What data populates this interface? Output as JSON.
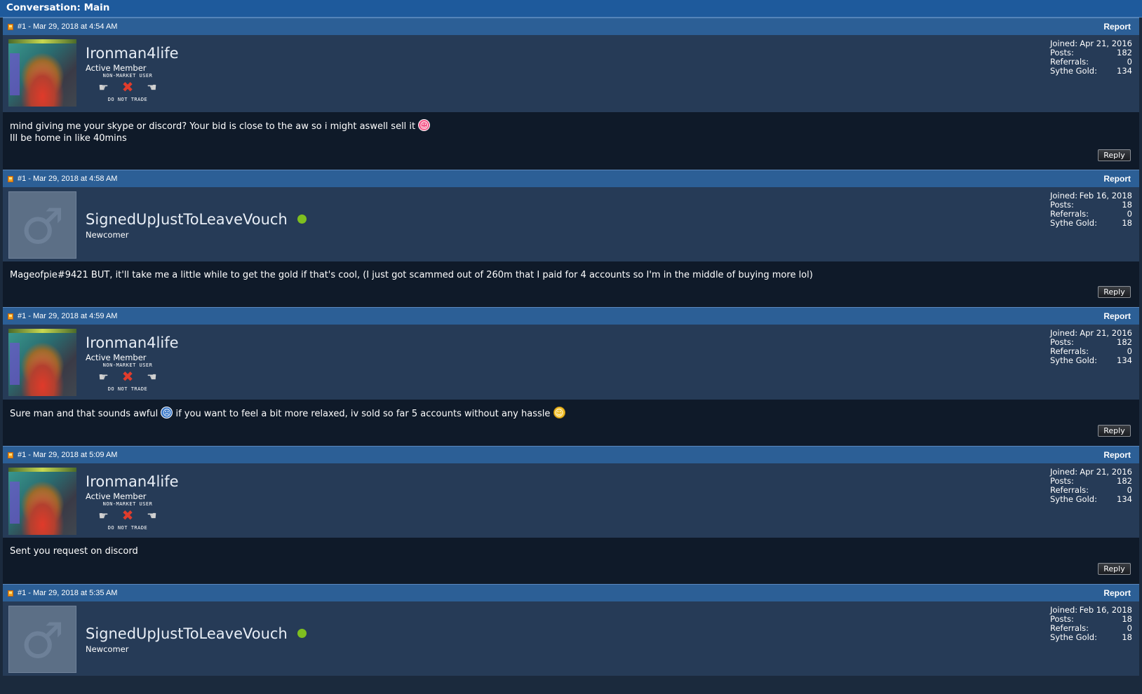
{
  "title": "Conversation: Main",
  "report_label": "Report",
  "reply_label": "Reply",
  "stat_labels": {
    "joined": "Joined:",
    "posts": "Posts:",
    "referrals": "Referrals:",
    "gold": "Sythe Gold:"
  },
  "badge": {
    "top": "NON-MARKET USER",
    "bottom": "DO NOT TRADE"
  },
  "users": {
    "iron": {
      "name": "Ironman4life",
      "title": "Active Member",
      "joined": "Apr 21, 2016",
      "posts": "182",
      "referrals": "0",
      "gold": "134"
    },
    "signed": {
      "name": "SignedUpJustToLeaveVouch",
      "title": "Newcomer",
      "joined": "Feb 16, 2018",
      "posts": "18",
      "referrals": "0",
      "gold": "18",
      "online_color": "#7fbf1f"
    }
  },
  "posts": [
    {
      "header": "#1 - Mar 29, 2018 at 4:54 AM",
      "line1": "mind giving me your skype or discord? Your bid is close to the aw so i might aswell sell it",
      "line2": "Ill be home in like 40mins"
    },
    {
      "header": "#1 - Mar 29, 2018 at 4:58 AM",
      "line1": "Mageofpie#9421 BUT, it'll take me a little while to get the gold if that's cool, (I just got scammed out of 260m that I paid for 4 accounts so I'm in the middle of buying more lol)"
    },
    {
      "header": "#1 - Mar 29, 2018 at 4:59 AM",
      "line1a": "Sure man and that sounds awful",
      "line1b": "if you want to feel a bit more relaxed, iv sold so far 5 accounts without any hassle"
    },
    {
      "header": "#1 - Mar 29, 2018 at 5:09 AM",
      "line1": "Sent you request on discord"
    },
    {
      "header": "#1 - Mar 29, 2018 at 5:35 AM"
    }
  ],
  "icons": {
    "post": "post-icon",
    "online": "online-dot",
    "avatar_default": "male-symbol-icon"
  },
  "colors": {
    "header_bar": "#2c5f96",
    "title_bar": "#1e5a9c",
    "userbar": "#263b57",
    "message_bg": "#0f1a29"
  }
}
